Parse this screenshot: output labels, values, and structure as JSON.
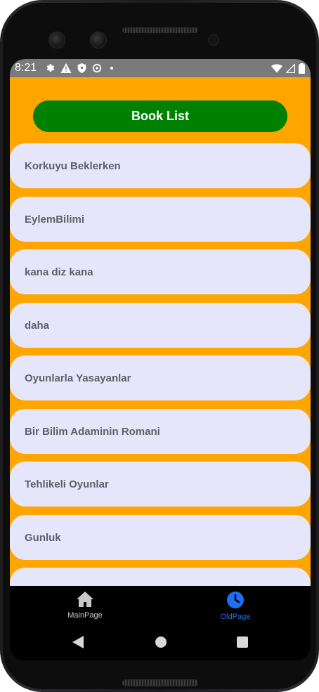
{
  "status_bar": {
    "time": "8:21",
    "icons_left": [
      "gear-icon",
      "warning-icon",
      "shield-icon",
      "sync-icon",
      "dot-icon"
    ],
    "icons_right": [
      "wifi-icon",
      "signal-icon",
      "battery-icon"
    ]
  },
  "header": {
    "title": "Book List"
  },
  "books": [
    "Korkuyu Beklerken",
    "EylemBilimi",
    "kana diz kana",
    "daha",
    "Oyunlarla Yasayanlar",
    "Bir Bilim Adaminin Romani",
    "Tehlikeli Oyunlar",
    "Gunluk",
    ""
  ],
  "bottom_nav": {
    "items": [
      {
        "label": "MainPage",
        "icon": "home-icon",
        "active": false
      },
      {
        "label": "OldPage",
        "icon": "clock-icon",
        "active": true
      }
    ]
  },
  "system_nav": [
    "back-icon",
    "home-circle-icon",
    "recents-icon"
  ],
  "colors": {
    "background": "#ffa500",
    "header_button": "#008000",
    "list_item": "#e6e6fa",
    "list_text": "#5f5f6b",
    "nav_active": "#1e6ff0",
    "nav_inactive": "#c8c8c8"
  }
}
